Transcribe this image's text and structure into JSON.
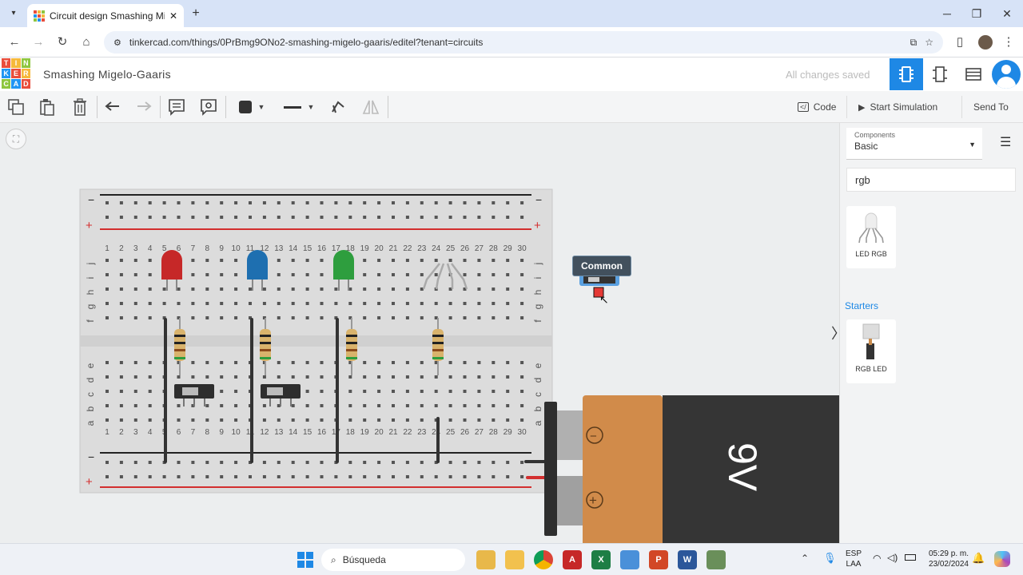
{
  "browser": {
    "tab_title": "Circuit design Smashing Migelo-Gaaris",
    "url": "tinkercad.com/things/0PrBmg9ONo2-smashing-migelo-gaaris/editel?tenant=circuits"
  },
  "app": {
    "logo_letters": [
      "T",
      "I",
      "N",
      "K",
      "E",
      "R",
      "C",
      "A",
      "D"
    ],
    "project_name": "Smashing Migelo-Gaaris",
    "save_status": "All changes saved"
  },
  "toolbar": {
    "code_label": "Code",
    "start_label": "Start Simulation",
    "send_label": "Send To"
  },
  "breadboard": {
    "column_numbers": [
      "1",
      "2",
      "3",
      "4",
      "5",
      "6",
      "7",
      "8",
      "9",
      "10",
      "11",
      "12",
      "13",
      "14",
      "15",
      "16",
      "17",
      "18",
      "19",
      "20",
      "21",
      "22",
      "23",
      "24",
      "25",
      "26",
      "27",
      "28",
      "29",
      "30"
    ],
    "top_row_letters": [
      "j",
      "i",
      "h",
      "g",
      "f"
    ],
    "bottom_row_letters": [
      "e",
      "d",
      "c",
      "b",
      "a"
    ],
    "minus": "−",
    "plus": "+"
  },
  "tooltip": "Common",
  "battery": {
    "label": "9V",
    "minus": "−",
    "plus": "+"
  },
  "panel": {
    "components_label": "Components",
    "components_value": "Basic",
    "search_value": "rgb",
    "result_label": "LED RGB",
    "starters_label": "Starters",
    "starter_label": "RGB LED"
  },
  "taskbar": {
    "search_label": "Búsqueda",
    "lang1": "ESP",
    "lang2": "LAA",
    "time": "05:29 p. m.",
    "date": "23/02/2024"
  }
}
